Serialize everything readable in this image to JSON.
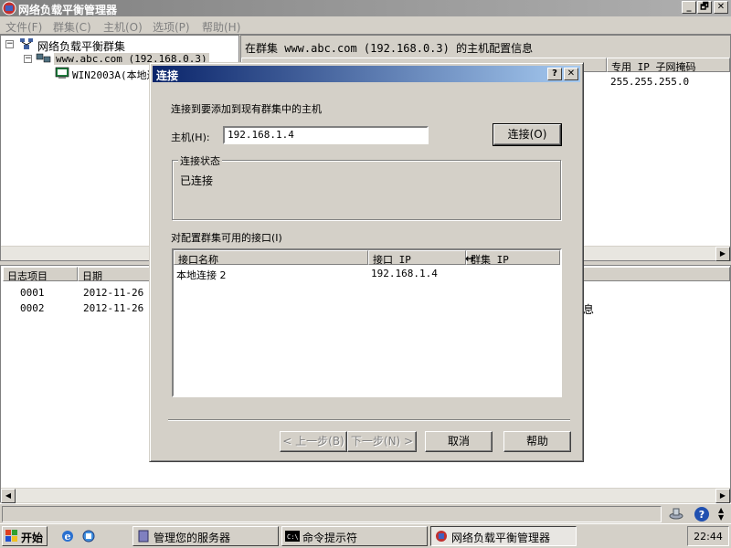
{
  "window": {
    "title": "网络负载平衡管理器",
    "controls": {
      "minimize": "_",
      "restore": "🗗",
      "close": "✕"
    }
  },
  "menu": [
    "文件(F)",
    "群集(C)",
    "主机(O)",
    "选项(P)",
    "帮助(H)"
  ],
  "tree": {
    "root": "网络负载平衡群集",
    "cluster": "www.abc.com (192.168.0.3)",
    "host": "WIN2003A(本地连接"
  },
  "config_pane": {
    "title": "在群集 www.abc.com (192.168.0.3) 的主机配置信息",
    "columns": [
      "专用 IP 子网掩码"
    ],
    "value": "255.255.255.0"
  },
  "log": {
    "columns": [
      "日志项目",
      "日期"
    ],
    "rows": [
      {
        "id": "0001",
        "date": "2012-11-26"
      },
      {
        "id": "0002",
        "date": "2012-11-26"
      }
    ],
    "partial_text": "息"
  },
  "dialog": {
    "title": "连接",
    "help_glyph": "?",
    "close_glyph": "✕",
    "intro": "连接到要添加到现有群集中的主机",
    "host_label": "主机(H):",
    "host_value": "192.168.1.4",
    "connect_button": "连接(O)",
    "status_group": "连接状态",
    "status_text": "已连接",
    "interfaces_label": "对配置群集可用的接口(I)",
    "columns": [
      "接口名称",
      "接口 IP",
      "群集 IP"
    ],
    "rows": [
      {
        "name": "本地连接 2",
        "ip": "192.168.1.4",
        "cluster_ip": ""
      }
    ],
    "buttons": {
      "back": "< 上一步(B)",
      "next": "下一步(N) >",
      "cancel": "取消",
      "help": "帮助"
    }
  },
  "taskbar": {
    "start": "开始",
    "tasks": [
      "管理您的服务器",
      "命令提示符",
      "网络负载平衡管理器"
    ],
    "clock": "22:44"
  },
  "colors": {
    "dialog_title_start": "#0a246a",
    "dialog_title_end": "#a6caf0",
    "face": "#d4d0c8"
  }
}
